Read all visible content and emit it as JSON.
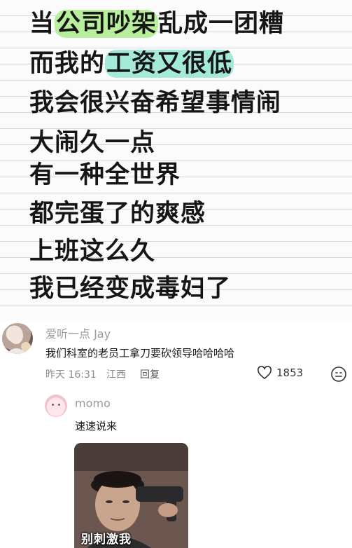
{
  "post": {
    "lines": [
      {
        "before": "当",
        "hl": "公司吵架",
        "after": "乱成一团糟"
      },
      {
        "before": "而我的",
        "hl": "工资又很低",
        "after": ""
      },
      {
        "text": "我会很兴奋希望事情闹"
      },
      {
        "text": "大闹久一点"
      },
      {
        "text": "有一种全世界"
      },
      {
        "text": "都完蛋了的爽感"
      },
      {
        "text": "上班这么久"
      },
      {
        "text": "我已经变成毒妇了"
      }
    ],
    "highlight_colors": {
      "green": "#b8ef9c",
      "teal": "#a4ead9"
    }
  },
  "comment": {
    "username": "爱听一点 Jay",
    "text": "我们科室的老员工拿刀要砍领导哈哈哈哈",
    "time": "昨天 16:31",
    "location": "江西",
    "reply_label": "回复",
    "like_count": "1853",
    "like_icon": "heart-outline-icon",
    "emoji_icon": "smiley-icon"
  },
  "reply": {
    "username": "momo",
    "text": "速速说来",
    "image_caption": "别刺激我"
  }
}
